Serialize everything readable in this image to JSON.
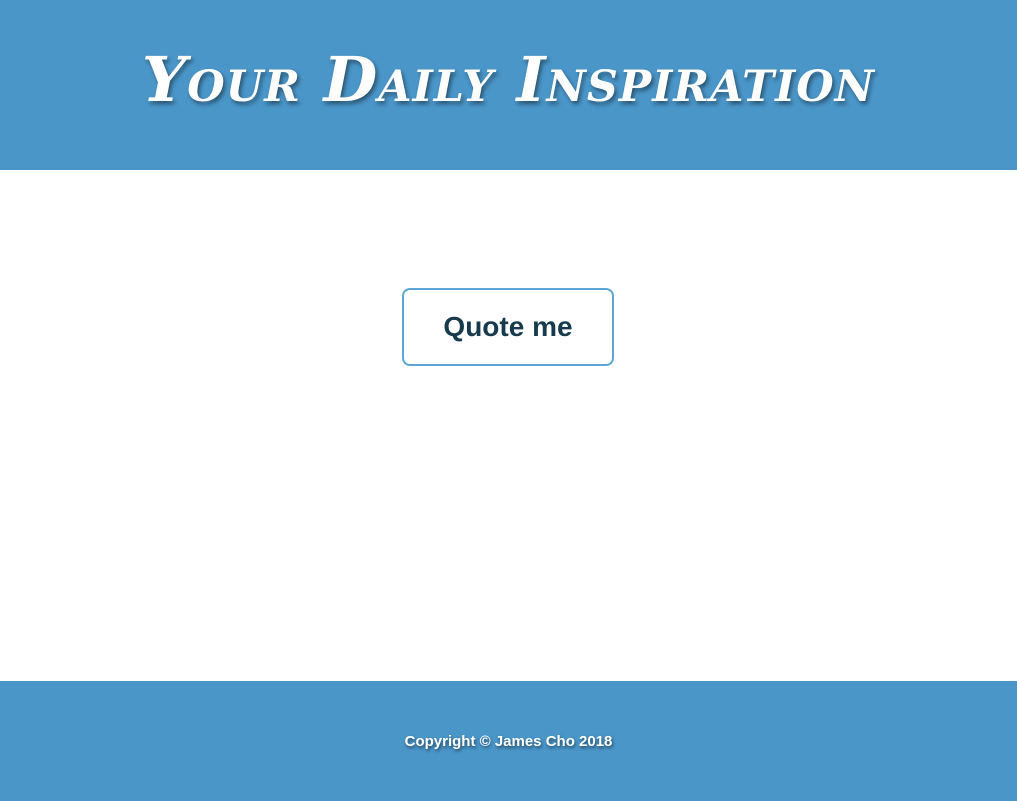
{
  "header": {
    "title": "Your Daily Inspiration"
  },
  "main": {
    "quote_button_label": "Quote me"
  },
  "footer": {
    "copyright": "Copyright © James Cho 2018"
  },
  "colors": {
    "header_background": "#4a96c9",
    "footer_background": "#4a96c9",
    "button_border": "#5aa6d8",
    "button_text": "#173a4d",
    "page_background": "#ffffff"
  }
}
